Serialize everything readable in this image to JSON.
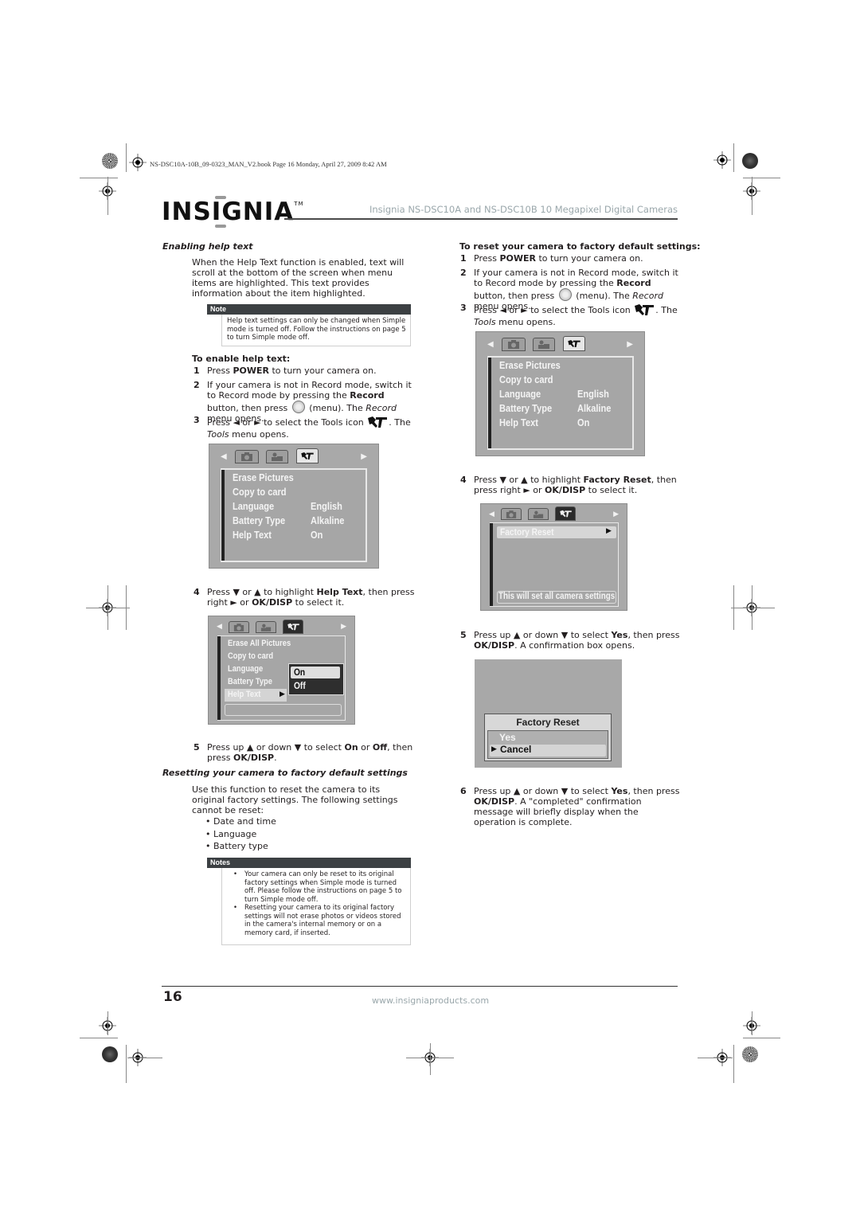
{
  "print_info": "NS-DSC10A-10B_09-0323_MAN_V2.book  Page 16  Monday, April 27, 2009  8:42 AM",
  "header": {
    "logo": "INSIGNIA",
    "logo_tm": "TM",
    "title": "Insignia NS-DSC10A and NS-DSC10B 10 Megapixel Digital Cameras"
  },
  "left": {
    "section1_title": "Enabling help text",
    "section1_body": "When the Help Text function is enabled, text will scroll at the bottom of the screen when menu items are highlighted. This text provides information about the item highlighted.",
    "note1": {
      "label": "Note",
      "text": "Help text settings can only be changed when Simple mode is turned off. Follow the instructions on page 5 to turn Simple mode off."
    },
    "procedure_title": "To enable help text:",
    "steps": [
      {
        "num": "1",
        "pre": "Press ",
        "bold": "POWER",
        "post": " to turn your camera on."
      },
      {
        "num": "2",
        "a": "If your camera is not in Record mode, switch it to Record mode by pressing the ",
        "b": "Record",
        "c": " button, then press ",
        "d": " (menu). The ",
        "e": "Record",
        "f": " menu opens."
      },
      {
        "num": "3",
        "a": "Press ◄ or ► to select the Tools icon ",
        "b": ". The ",
        "c": "Tools",
        "d": " menu opens."
      },
      {
        "num": "4",
        "a": "Press ▼ or ▲ to highlight ",
        "b": "Help Text",
        "c": ", then press right ► or ",
        "d": "OK/DISP",
        "e": " to select it."
      },
      {
        "num": "5",
        "a": "Press up ▲ or down ▼ to select ",
        "b": "On",
        "c": " or ",
        "d": "Off",
        "e": ", then press ",
        "f": "OK/DISP",
        "g": "."
      }
    ],
    "screen1": {
      "items": [
        "Erase Pictures",
        "Copy to card",
        "Language",
        "Battery Type",
        "Help Text"
      ],
      "values": [
        "",
        "",
        "English",
        "Alkaline",
        "On"
      ]
    },
    "screen2": {
      "items": [
        "Erase All Pictures",
        "Copy to card",
        "Language",
        "Battery Type",
        "Help Text"
      ],
      "options": [
        "On",
        "Off"
      ],
      "selected_option": "On"
    },
    "section2_title": "Resetting your camera to factory default settings",
    "section2_body": "Use this function to reset the camera to its original factory settings. The following settings cannot be reset:",
    "cannot_reset": [
      "Date and time",
      "Language",
      "Battery type"
    ],
    "note2": {
      "label": "Notes",
      "items": [
        "Your camera can only be reset to its original factory settings when Simple mode is turned off. Please follow the instructions on page 5 to turn Simple mode off.",
        "Resetting your camera to its original factory settings will not erase photos or videos stored in the camera's internal memory or on a memory card, if inserted."
      ]
    }
  },
  "right": {
    "procedure_title": "To reset your camera to factory default settings:",
    "steps": [
      {
        "num": "1",
        "pre": "Press ",
        "bold": "POWER",
        "post": " to turn your camera on."
      },
      {
        "num": "2",
        "a": "If your camera is not in Record mode, switch it to Record mode by pressing the ",
        "b": "Record",
        "c": " button, then press ",
        "d": " (menu). The ",
        "e": "Record",
        "f": " menu opens."
      },
      {
        "num": "3",
        "a": "Press ◄ or ► to select the Tools icon ",
        "b": ". The ",
        "c": "Tools",
        "d": " menu opens."
      },
      {
        "num": "4",
        "a": "Press ▼ or ▲ to highlight ",
        "b": "Factory Reset",
        "c": ", then press right ► or ",
        "d": "OK/DISP",
        "e": " to select it."
      },
      {
        "num": "5",
        "a": "Press up ▲ or down ▼ to select ",
        "b": "Yes",
        "c": ", then press ",
        "d": "OK/DISP",
        "e": ". A confirmation box opens."
      },
      {
        "num": "6",
        "a": "Press up ▲ or down ▼ to select ",
        "b": "Yes",
        "c": ", then press ",
        "d": "OK/DISP",
        "e": ". A \"completed\" confirmation message will briefly display when the operation is complete."
      }
    ],
    "screen1": {
      "items": [
        "Erase Pictures",
        "Copy to card",
        "Language",
        "Battery Type",
        "Help Text"
      ],
      "values": [
        "",
        "",
        "English",
        "Alkaline",
        "On"
      ]
    },
    "screen2": {
      "item": "Factory Reset",
      "help": "This will set all camera settings"
    },
    "screen3": {
      "title": "Factory Reset",
      "options": [
        "Yes",
        "Cancel"
      ],
      "selected": "Cancel"
    }
  },
  "footer": {
    "page": "16",
    "url": "www.insigniaproducts.com"
  }
}
